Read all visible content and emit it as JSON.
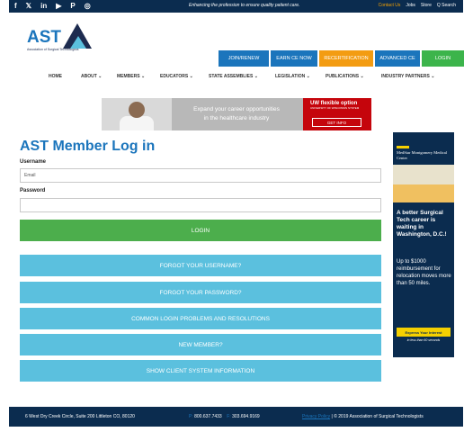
{
  "topbar": {
    "social": [
      "f",
      "𝕏",
      "in",
      "▶",
      "P",
      "◎"
    ],
    "tagline": "Enhancing the profession to ensure quality patient care.",
    "links": {
      "contact": "Contact Us",
      "jobs": "Jobs",
      "store": "Store",
      "search": "Q  Search"
    }
  },
  "header": {
    "logo_text": "AST",
    "logo_sub": "Association of Surgical Technologists",
    "cta": {
      "join": "JOIN/RENEW",
      "earn": "EARN CE NOW",
      "recert": "RECERTIFICATION",
      "advanced": "ADVANCED CE",
      "login": "LOGIN"
    }
  },
  "nav": [
    "HOME",
    "ABOUT ⌄",
    "MEMBERS ⌄",
    "EDUCATORS ⌄",
    "STATE ASSEMBLIES ⌄",
    "LEGISLATION ⌄",
    "PUBLICATIONS ⌄",
    "INDUSTRY PARTNERS ⌄"
  ],
  "banner": {
    "text_line1": "Expand your career opportunities",
    "text_line2": "in the healthcare industry",
    "brand": "UW flexible option",
    "brand_sub": "UNIVERSITY OF WISCONSIN SYSTEM",
    "cta": "GET INFO"
  },
  "form": {
    "title": "AST Member Log in",
    "username_label": "Username",
    "username_placeholder": "Email",
    "password_label": "Password",
    "login_button": "LOGIN",
    "forgot_username": "FORGOT YOUR USERNAME?",
    "forgot_password": "FORGOT YOUR PASSWORD?",
    "common_problems": "COMMON LOGIN PROBLEMS AND RESOLUTIONS",
    "new_member": "NEW MEMBER?",
    "show_client_info": "SHOW CLIENT SYSTEM INFORMATION"
  },
  "ad": {
    "org": "MedStar Montgomery Medical Center",
    "headline": "A better Surgical Tech career is waiting in Washington, D.C.!",
    "body": "Up to $1000 reimbursement for relocation moves more than 50 miles.",
    "cta": "Express Your Interest",
    "note": "in less than 60 seconds"
  },
  "footer": {
    "address": "6 West Dry Creek Circle, Suite 200 Littleton CO, 80120",
    "phone_label": "P:",
    "phone": "800.637.7433",
    "fax_label": "F:",
    "fax": "303.694.9169",
    "privacy": "Privacy Policy",
    "copyright": "| © 2019 Association of Surgical Technologists"
  },
  "colors": {
    "navy": "#0b2c4f",
    "blue": "#1b75bc",
    "orange": "#f39c12",
    "green": "#4cae4c",
    "light_blue": "#5bc0de"
  }
}
